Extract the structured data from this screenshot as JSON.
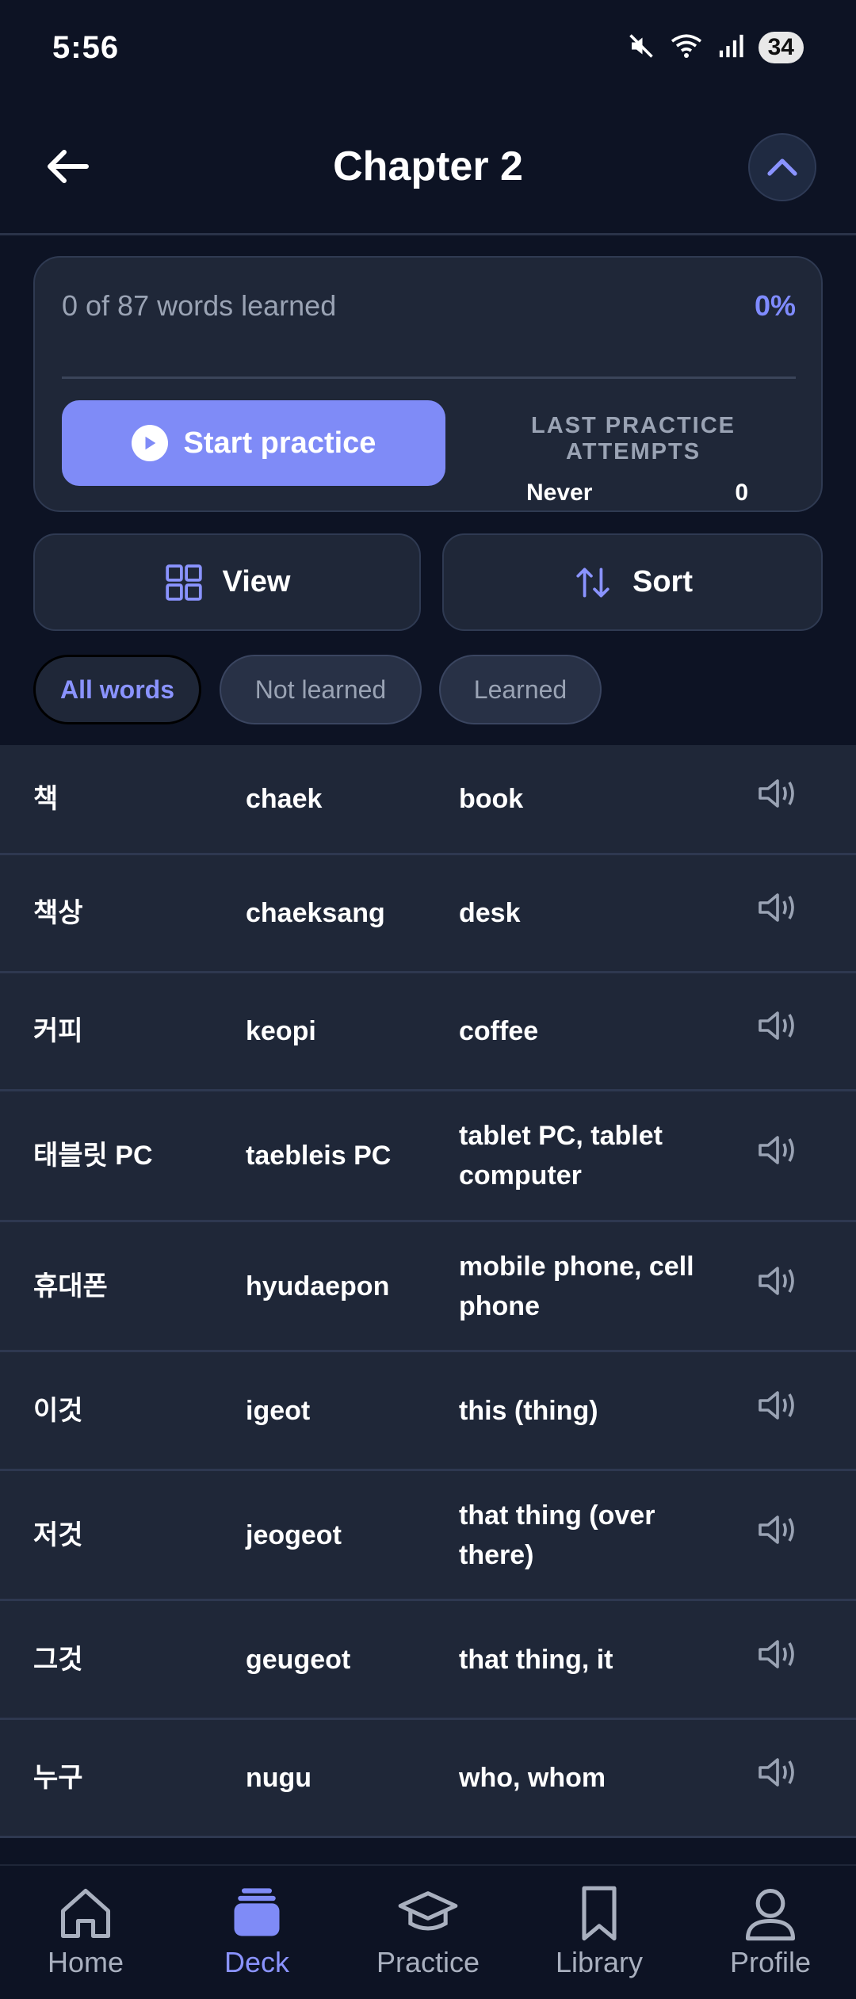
{
  "status_bar": {
    "time": "5:56",
    "battery": "34",
    "icons": [
      "mute-icon",
      "wifi-icon",
      "signal-icon",
      "battery-icon"
    ]
  },
  "header": {
    "title": "Chapter 2"
  },
  "progress": {
    "learned_text": "0 of 87 words learned",
    "percent_text": "0%",
    "start_label": "Start practice",
    "last_practice_title": "LAST PRACTICE ATTEMPTS",
    "last_practice_value": "Never",
    "attempts_value": "0"
  },
  "actions": {
    "view_label": "View",
    "sort_label": "Sort"
  },
  "filters": {
    "all": "All words",
    "not_learned": "Not learned",
    "learned": "Learned"
  },
  "words": [
    {
      "korean": "책",
      "romanization": "chaek",
      "english": "book"
    },
    {
      "korean": "책상",
      "romanization": "chaeksang",
      "english": "desk"
    },
    {
      "korean": "커피",
      "romanization": "keopi",
      "english": "coffee"
    },
    {
      "korean": "태블릿 PC",
      "romanization": "taebleis PC",
      "english": "tablet PC, tablet computer"
    },
    {
      "korean": "휴대폰",
      "romanization": "hyudaepon",
      "english": "mobile phone, cell phone"
    },
    {
      "korean": "이것",
      "romanization": "igeot",
      "english": "this (thing)"
    },
    {
      "korean": "저것",
      "romanization": "jeogeot",
      "english": "that thing (over there)"
    },
    {
      "korean": "그것",
      "romanization": "geugeot",
      "english": "that thing, it"
    },
    {
      "korean": "누구",
      "romanization": "nugu",
      "english": "who, whom"
    }
  ],
  "nav": {
    "home": "Home",
    "deck": "Deck",
    "practice": "Practice",
    "library": "Library",
    "profile": "Profile"
  },
  "colors": {
    "accent": "#7f8bf7",
    "background": "#0d1324",
    "card": "#1f2738"
  }
}
